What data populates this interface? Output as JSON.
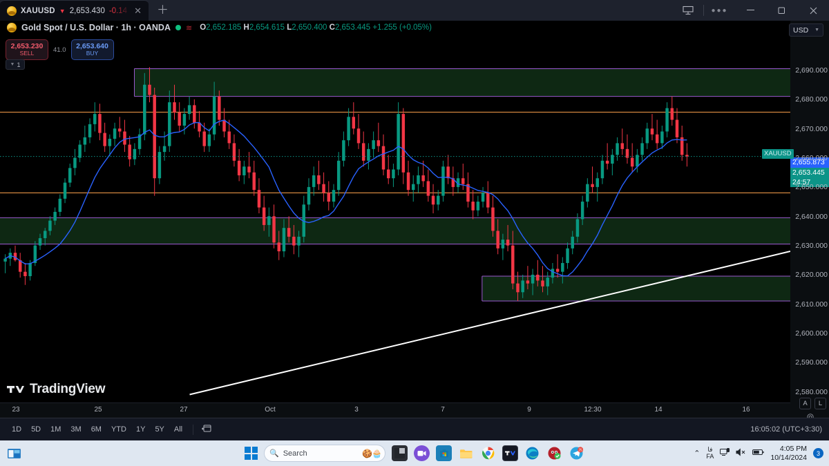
{
  "window": {
    "tab": {
      "symbol": "XAUUSD",
      "direction_icon": "triangle-down-icon",
      "price": "2,653.430",
      "change": "-0.14",
      "close_icon": "close-icon",
      "new_tab_icon": "plus-icon"
    },
    "controls": {
      "layout_icon": "layout-icon",
      "more_icon": "more-options-icon",
      "minimize_icon": "minimize-icon",
      "maximize_icon": "maximize-icon",
      "close_icon": "close-icon"
    }
  },
  "legend": {
    "title": "Gold Spot / U.S. Dollar · 1h · OANDA",
    "status_icon": "connection-dot-icon",
    "data_icon": "data-source-icon",
    "o_label": "O",
    "o_value": "2,652.185",
    "h_label": "H",
    "h_value": "2,654.615",
    "l_label": "L",
    "l_value": "2,650.400",
    "c_label": "C",
    "c_value": "2,653.445",
    "change": "+1.255 (+0.05%)"
  },
  "currency_selector": {
    "value": "USD",
    "caret_icon": "chevron-down-icon"
  },
  "order_widget": {
    "sell_price": "2,653.230",
    "sell_label": "SELL",
    "spread": "41.0",
    "buy_price": "2,653.640",
    "buy_label": "BUY",
    "quantity": "1",
    "quantity_caret_icon": "chevron-down-icon"
  },
  "price_scale": {
    "labels": [
      "2,690.000",
      "2,680.000",
      "2,670.000",
      "2,660.000",
      "2,650.000",
      "2,640.000",
      "2,630.000",
      "2,620.000",
      "2,610.000",
      "2,600.000",
      "2,590.000",
      "2,580.000"
    ],
    "crosshair_price": "2,655.873",
    "last_price": "2,653.445",
    "countdown": "24:57",
    "symbol_tag": "XAUUSD"
  },
  "scale_controls": {
    "auto_label": "A",
    "log_label": "L",
    "settings_icon": "gear-icon"
  },
  "time_scale": {
    "labels": [
      "23",
      "25",
      "27",
      "Oct",
      "3",
      "7",
      "9",
      "12:30",
      "14",
      "16"
    ]
  },
  "bottom_toolbar": {
    "ranges": [
      "1D",
      "5D",
      "1M",
      "3M",
      "6M",
      "YTD",
      "1Y",
      "5Y",
      "All"
    ],
    "calendar_icon": "calendar-range-icon",
    "clock": "16:05:02 (UTC+3:30)"
  },
  "watermark": {
    "logo_icon": "tradingview-logo-icon",
    "text": "TradingView"
  },
  "taskbar": {
    "task_view_icon": "task-view-icon",
    "start_icon": "windows-start-icon",
    "search_placeholder": "Search",
    "search_icon": "search-icon",
    "apps": [
      {
        "name": "file-explorer-dark-icon",
        "glyph": "◨"
      },
      {
        "name": "zoom-app-icon",
        "glyph": "▭"
      },
      {
        "name": "microsoft-store-icon",
        "glyph": "▦"
      },
      {
        "name": "file-explorer-icon",
        "glyph": "📁"
      },
      {
        "name": "google-chrome-icon",
        "glyph": "◉"
      },
      {
        "name": "tradingview-app-icon",
        "glyph": "TV"
      },
      {
        "name": "microsoft-edge-icon",
        "glyph": "◎"
      },
      {
        "name": "antivirus-icon",
        "glyph": "◔"
      },
      {
        "name": "telegram-icon",
        "glyph": "➤"
      }
    ],
    "tray": {
      "overflow_icon": "chevron-up-icon",
      "language": "FA",
      "language_native": "فا",
      "network_icon": "network-icon",
      "volume_icon": "volume-muted-icon",
      "battery_icon": "battery-icon",
      "time": "4:05 PM",
      "date": "10/14/2024",
      "notification_count": "3"
    }
  },
  "colors": {
    "accent_blue": "#2962ff",
    "teal": "#0c9488",
    "up": "#089981",
    "down": "#f23645",
    "zone_fill": "#0f2a14",
    "zone_border": "#9b59d0",
    "orange_line": "#d4873f",
    "trendline": "#ffffff",
    "ma_line": "#2962ff",
    "background": "#000000"
  },
  "chart_data": {
    "type": "candlestick",
    "title": "Gold Spot / U.S. Dollar · 1h · OANDA",
    "xlabel": "",
    "ylabel": "USD",
    "ylim": [
      2574,
      2694
    ],
    "y_ticks": [
      2690,
      2680,
      2670,
      2660,
      2650,
      2640,
      2630,
      2620,
      2610,
      2600,
      2590,
      2580
    ],
    "x_ticks": [
      "23",
      "25",
      "27",
      "Oct",
      "3",
      "7",
      "9",
      "12:30",
      "14",
      "16"
    ],
    "grid": false,
    "legend_position": "top-left",
    "ohlc_current": {
      "open": 2652.185,
      "high": 2654.615,
      "low": 2650.4,
      "close": 2653.445,
      "change": 1.255,
      "change_pct": 0.05
    },
    "last_price": 2653.445,
    "crosshair_price": 2655.873,
    "overlays": [
      {
        "name": "moving-average",
        "type": "line",
        "color": "#2962ff"
      },
      {
        "name": "supply-zone-upper",
        "type": "rect",
        "y_top": 2683.5,
        "y_bottom": 2674.0,
        "x_start_pct": 17,
        "x_end_pct": 100,
        "fill": "#0f2a14",
        "border": "#9b59d0"
      },
      {
        "name": "demand-zone-mid",
        "type": "rect",
        "y_top": 2632.5,
        "y_bottom": 2623.5,
        "x_start_pct": 0,
        "x_end_pct": 100,
        "fill": "#0f2a14",
        "border": "#9b59d0"
      },
      {
        "name": "demand-zone-lower",
        "type": "rect",
        "y_top": 2612.5,
        "y_bottom": 2604.0,
        "x_start_pct": 61,
        "x_end_pct": 100,
        "fill": "#0f2a14",
        "border": "#9b59d0"
      },
      {
        "name": "resistance-line",
        "type": "hline",
        "y": 2668.6,
        "color": "#d4873f"
      },
      {
        "name": "support-line",
        "type": "hline",
        "y": 2641.0,
        "color": "#d4873f"
      },
      {
        "name": "ascending-trendline",
        "type": "trendline",
        "x1_pct": 24,
        "y1": 2572,
        "x2_pct": 100,
        "y2": 2621,
        "color": "#ffffff"
      }
    ],
    "candles": [
      [
        2617.5,
        2620.0,
        2613.5,
        2618.5
      ],
      [
        2618.5,
        2622.0,
        2616.0,
        2620.5
      ],
      [
        2620.5,
        2623.0,
        2617.5,
        2618.0
      ],
      [
        2618.0,
        2620.5,
        2612.0,
        2614.0
      ],
      [
        2614.0,
        2617.0,
        2609.5,
        2612.5
      ],
      [
        2612.5,
        2618.0,
        2611.0,
        2617.0
      ],
      [
        2617.0,
        2624.5,
        2616.0,
        2623.0
      ],
      [
        2623.0,
        2627.0,
        2621.5,
        2625.5
      ],
      [
        2625.5,
        2629.0,
        2623.0,
        2628.0
      ],
      [
        2628.0,
        2633.0,
        2626.5,
        2631.5
      ],
      [
        2631.5,
        2636.0,
        2630.0,
        2634.5
      ],
      [
        2634.5,
        2640.5,
        2633.0,
        2639.0
      ],
      [
        2639.0,
        2646.0,
        2637.5,
        2644.5
      ],
      [
        2644.5,
        2651.0,
        2643.0,
        2649.5
      ],
      [
        2649.5,
        2656.0,
        2647.0,
        2653.0
      ],
      [
        2653.0,
        2659.0,
        2651.5,
        2657.5
      ],
      [
        2657.5,
        2664.0,
        2655.0,
        2660.0
      ],
      [
        2660.0,
        2666.5,
        2658.0,
        2664.5
      ],
      [
        2664.5,
        2672.0,
        2662.0,
        2668.0
      ],
      [
        2668.0,
        2671.5,
        2659.0,
        2661.5
      ],
      [
        2661.5,
        2665.0,
        2655.0,
        2657.0
      ],
      [
        2657.0,
        2661.0,
        2653.5,
        2659.5
      ],
      [
        2659.5,
        2665.0,
        2657.0,
        2663.0
      ],
      [
        2663.0,
        2667.0,
        2660.0,
        2662.0
      ],
      [
        2662.0,
        2666.0,
        2655.0,
        2657.5
      ],
      [
        2657.5,
        2660.5,
        2650.0,
        2652.5
      ],
      [
        2652.5,
        2658.0,
        2650.5,
        2656.0
      ],
      [
        2656.0,
        2663.0,
        2654.0,
        2661.0
      ],
      [
        2661.0,
        2682.0,
        2659.0,
        2678.0
      ],
      [
        2678.0,
        2684.0,
        2672.0,
        2674.5
      ],
      [
        2674.5,
        2677.0,
        2640.0,
        2646.0
      ],
      [
        2646.0,
        2657.0,
        2644.0,
        2655.0
      ],
      [
        2655.0,
        2662.0,
        2652.0,
        2657.0
      ],
      [
        2657.0,
        2676.0,
        2655.0,
        2672.0
      ],
      [
        2672.0,
        2678.0,
        2666.0,
        2668.5
      ],
      [
        2668.5,
        2672.0,
        2662.0,
        2664.0
      ],
      [
        2664.0,
        2670.0,
        2661.0,
        2668.0
      ],
      [
        2668.0,
        2674.0,
        2666.0,
        2671.0
      ],
      [
        2671.0,
        2673.0,
        2663.0,
        2665.0
      ],
      [
        2665.0,
        2669.0,
        2660.0,
        2662.0
      ],
      [
        2662.0,
        2665.0,
        2655.0,
        2657.0
      ],
      [
        2657.0,
        2663.0,
        2655.0,
        2661.0
      ],
      [
        2661.0,
        2679.0,
        2659.0,
        2674.0
      ],
      [
        2674.0,
        2676.0,
        2664.0,
        2666.0
      ],
      [
        2666.0,
        2670.0,
        2660.0,
        2662.0
      ],
      [
        2662.0,
        2666.0,
        2656.0,
        2658.0
      ],
      [
        2658.0,
        2661.0,
        2650.0,
        2652.0
      ],
      [
        2652.0,
        2656.0,
        2645.0,
        2647.0
      ],
      [
        2647.0,
        2652.0,
        2644.0,
        2650.0
      ],
      [
        2650.0,
        2655.0,
        2646.0,
        2648.0
      ],
      [
        2648.0,
        2652.0,
        2640.0,
        2642.0
      ],
      [
        2642.0,
        2646.0,
        2634.0,
        2636.0
      ],
      [
        2636.0,
        2640.0,
        2628.0,
        2630.0
      ],
      [
        2630.0,
        2636.0,
        2626.0,
        2633.0
      ],
      [
        2633.0,
        2637.0,
        2622.0,
        2624.0
      ],
      [
        2624.0,
        2628.0,
        2618.0,
        2621.0
      ],
      [
        2621.0,
        2632.0,
        2619.0,
        2629.0
      ],
      [
        2629.0,
        2633.0,
        2624.0,
        2626.0
      ],
      [
        2626.0,
        2630.0,
        2620.0,
        2623.0
      ],
      [
        2623.0,
        2628.0,
        2619.0,
        2626.0
      ],
      [
        2626.0,
        2640.0,
        2624.0,
        2637.0
      ],
      [
        2637.0,
        2646.0,
        2635.0,
        2643.0
      ],
      [
        2643.0,
        2650.0,
        2640.0,
        2647.0
      ],
      [
        2647.0,
        2652.0,
        2642.0,
        2644.0
      ],
      [
        2644.0,
        2648.0,
        2638.0,
        2641.0
      ],
      [
        2641.0,
        2645.0,
        2635.0,
        2638.0
      ],
      [
        2638.0,
        2644.0,
        2636.0,
        2642.0
      ],
      [
        2642.0,
        2655.0,
        2640.0,
        2652.0
      ],
      [
        2652.0,
        2662.0,
        2650.0,
        2659.0
      ],
      [
        2659.0,
        2670.0,
        2657.0,
        2667.0
      ],
      [
        2667.0,
        2672.0,
        2661.0,
        2663.0
      ],
      [
        2663.0,
        2668.0,
        2656.0,
        2658.0
      ],
      [
        2658.0,
        2662.0,
        2650.0,
        2652.0
      ],
      [
        2652.0,
        2658.0,
        2649.0,
        2656.0
      ],
      [
        2656.0,
        2662.0,
        2653.0,
        2659.0
      ],
      [
        2659.0,
        2665.0,
        2655.0,
        2657.0
      ],
      [
        2657.0,
        2661.0,
        2647.0,
        2649.0
      ],
      [
        2649.0,
        2654.0,
        2644.0,
        2646.0
      ],
      [
        2646.0,
        2651.0,
        2643.0,
        2649.0
      ],
      [
        2649.0,
        2672.0,
        2647.0,
        2668.0
      ],
      [
        2668.0,
        2670.0,
        2644.0,
        2648.0
      ],
      [
        2648.0,
        2652.0,
        2640.0,
        2642.0
      ],
      [
        2642.0,
        2647.0,
        2638.0,
        2644.0
      ],
      [
        2644.0,
        2650.0,
        2641.0,
        2647.0
      ],
      [
        2647.0,
        2652.0,
        2643.0,
        2645.0
      ],
      [
        2645.0,
        2649.0,
        2638.0,
        2640.0
      ],
      [
        2640.0,
        2644.0,
        2634.0,
        2637.0
      ],
      [
        2637.0,
        2642.0,
        2635.0,
        2640.0
      ],
      [
        2640.0,
        2652.0,
        2638.0,
        2650.0
      ],
      [
        2650.0,
        2654.0,
        2644.0,
        2646.0
      ],
      [
        2646.0,
        2650.0,
        2640.0,
        2643.0
      ],
      [
        2643.0,
        2648.0,
        2641.0,
        2646.0
      ],
      [
        2646.0,
        2651.0,
        2642.0,
        2644.0
      ],
      [
        2644.0,
        2648.0,
        2636.0,
        2638.0
      ],
      [
        2638.0,
        2642.0,
        2632.0,
        2635.0
      ],
      [
        2635.0,
        2640.0,
        2633.0,
        2638.0
      ],
      [
        2638.0,
        2643.0,
        2636.0,
        2641.0
      ],
      [
        2641.0,
        2645.0,
        2634.0,
        2636.0
      ],
      [
        2636.0,
        2640.0,
        2626.0,
        2628.0
      ],
      [
        2628.0,
        2632.0,
        2620.0,
        2622.0
      ],
      [
        2622.0,
        2627.0,
        2618.0,
        2625.0
      ],
      [
        2625.0,
        2630.0,
        2621.0,
        2623.0
      ],
      [
        2623.0,
        2628.0,
        2608.0,
        2610.0
      ],
      [
        2610.0,
        2614.0,
        2604.0,
        2607.0
      ],
      [
        2607.0,
        2613.0,
        2605.0,
        2611.0
      ],
      [
        2611.0,
        2616.0,
        2608.0,
        2610.0
      ],
      [
        2610.0,
        2615.0,
        2606.0,
        2613.0
      ],
      [
        2613.0,
        2618.0,
        2609.0,
        2611.0
      ],
      [
        2611.0,
        2616.0,
        2607.0,
        2609.0
      ],
      [
        2609.0,
        2614.0,
        2606.0,
        2612.0
      ],
      [
        2612.0,
        2617.0,
        2610.0,
        2615.0
      ],
      [
        2615.0,
        2620.0,
        2612.0,
        2614.0
      ],
      [
        2614.0,
        2619.0,
        2610.0,
        2617.0
      ],
      [
        2617.0,
        2624.0,
        2615.0,
        2622.0
      ],
      [
        2622.0,
        2628.0,
        2620.0,
        2626.0
      ],
      [
        2626.0,
        2634.0,
        2624.0,
        2632.0
      ],
      [
        2632.0,
        2640.0,
        2630.0,
        2638.0
      ],
      [
        2638.0,
        2646.0,
        2636.0,
        2644.0
      ],
      [
        2644.0,
        2650.0,
        2641.0,
        2643.0
      ],
      [
        2643.0,
        2648.0,
        2638.0,
        2646.0
      ],
      [
        2646.0,
        2654.0,
        2644.0,
        2652.0
      ],
      [
        2652.0,
        2658.0,
        2649.0,
        2651.0
      ],
      [
        2651.0,
        2656.0,
        2647.0,
        2654.0
      ],
      [
        2654.0,
        2660.0,
        2652.0,
        2658.0
      ],
      [
        2658.0,
        2663.0,
        2654.0,
        2656.0
      ],
      [
        2656.0,
        2661.0,
        2651.0,
        2653.0
      ],
      [
        2653.0,
        2658.0,
        2648.0,
        2650.0
      ],
      [
        2650.0,
        2656.0,
        2648.0,
        2654.0
      ],
      [
        2654.0,
        2660.0,
        2652.0,
        2658.0
      ],
      [
        2658.0,
        2665.0,
        2656.0,
        2663.0
      ],
      [
        2663.0,
        2668.0,
        2659.0,
        2661.0
      ],
      [
        2661.0,
        2666.0,
        2656.0,
        2658.0
      ],
      [
        2658.0,
        2664.0,
        2656.0,
        2662.0
      ],
      [
        2662.0,
        2672.0,
        2660.0,
        2670.0
      ],
      [
        2670.0,
        2674.0,
        2664.0,
        2666.0
      ],
      [
        2666.0,
        2670.0,
        2658.0,
        2660.0
      ],
      [
        2660.0,
        2664.0,
        2652.0,
        2654.0
      ],
      [
        2654.0,
        2658.0,
        2650.0,
        2653.445
      ]
    ]
  }
}
